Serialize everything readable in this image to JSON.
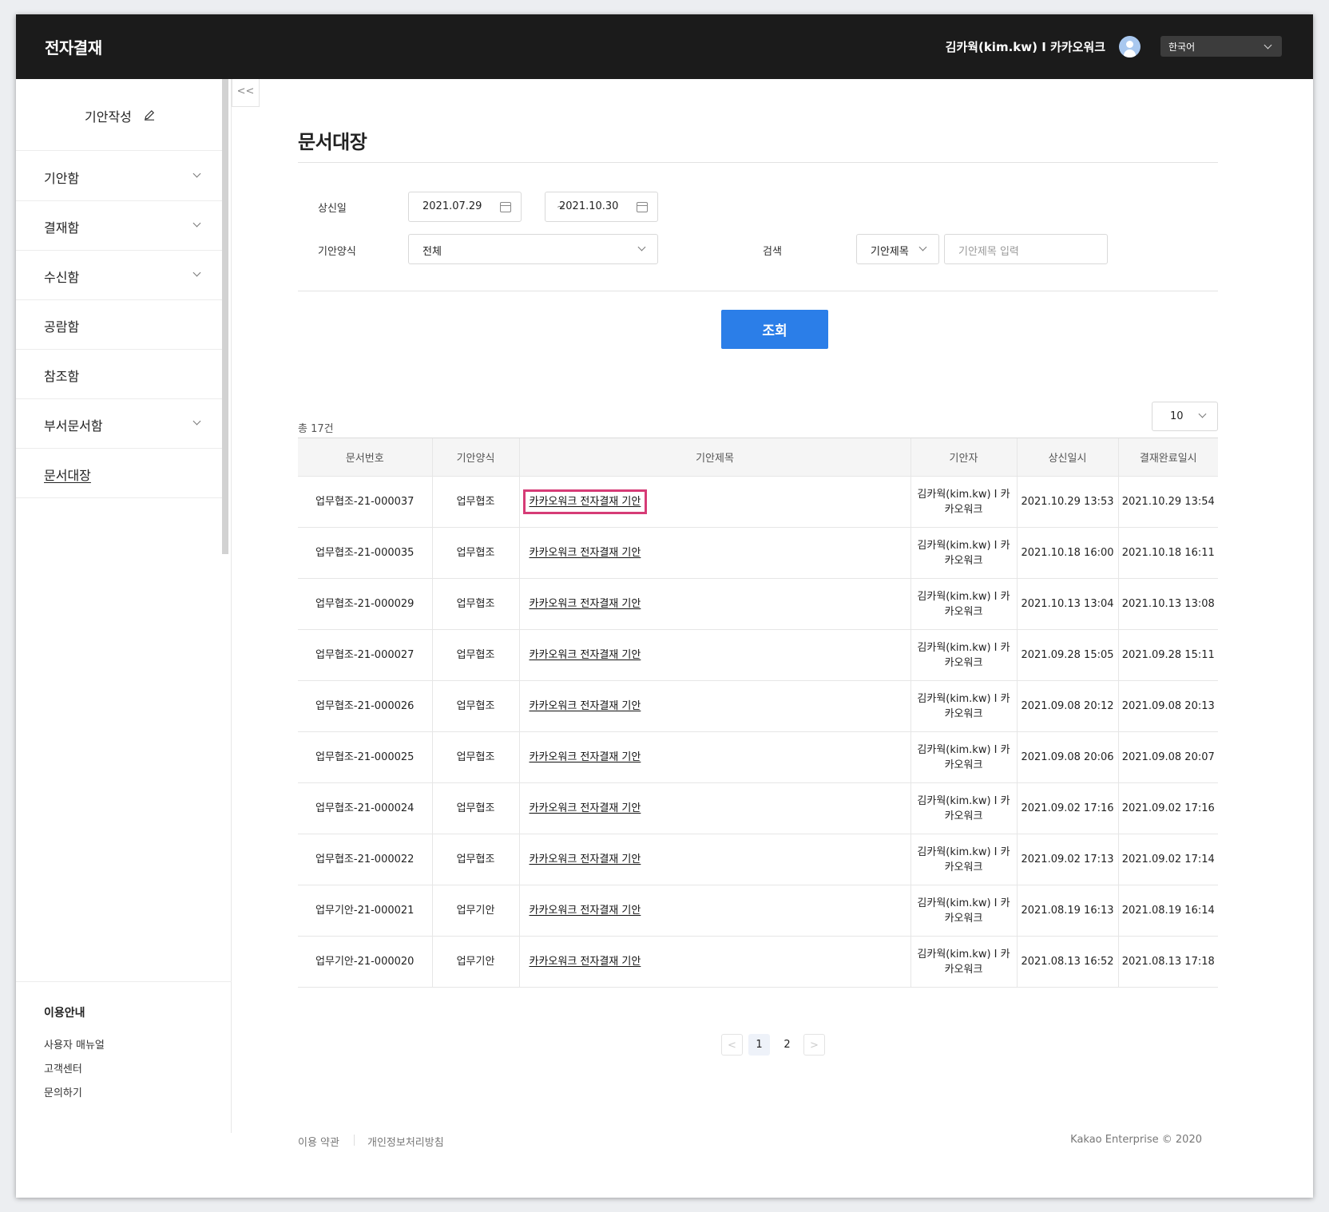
{
  "header": {
    "app_title": "전자결재",
    "user": "김카웍(kim.kw) I 카카오워크",
    "language": "한국어"
  },
  "sidebar": {
    "compose": "기안작성",
    "collapse": "<<",
    "items": [
      {
        "label": "기안함"
      },
      {
        "label": "결재함"
      },
      {
        "label": "수신함"
      },
      {
        "label": "공람함"
      },
      {
        "label": "참조함"
      },
      {
        "label": "부서문서함"
      },
      {
        "label": "문서대장"
      }
    ],
    "guide": {
      "title": "이용안내",
      "links": [
        "사용자 매뉴얼",
        "고객센터",
        "문의하기"
      ]
    }
  },
  "main": {
    "title": "문서대장",
    "filters": {
      "date_label": "상신일",
      "date_from": "2021.07.29",
      "date_to": "2021.10.30",
      "tilde": "~",
      "form_label": "기안양식",
      "form_value": "전체",
      "search_label": "검색",
      "search_type": "기안제목",
      "search_placeholder": "기안제목 입력"
    },
    "search_button": "조회",
    "total": "총 17건",
    "page_size": "10",
    "table": {
      "headers": [
        "문서번호",
        "기안양식",
        "기안제목",
        "기안자",
        "상신일시",
        "결재완료일시"
      ],
      "rows": [
        [
          "업무협조-21-000037",
          "업무협조",
          "카카오워크 전자결재 기안",
          "김카웍(kim.kw) I 카카오워크",
          "2021.10.29 13:53",
          "2021.10.29 13:54"
        ],
        [
          "업무협조-21-000035",
          "업무협조",
          "카카오워크 전자결재 기안",
          "김카웍(kim.kw) I 카카오워크",
          "2021.10.18 16:00",
          "2021.10.18 16:11"
        ],
        [
          "업무협조-21-000029",
          "업무협조",
          "카카오워크 전자결재 기안",
          "김카웍(kim.kw) I 카카오워크",
          "2021.10.13 13:04",
          "2021.10.13 13:08"
        ],
        [
          "업무협조-21-000027",
          "업무협조",
          "카카오워크 전자결재 기안",
          "김카웍(kim.kw) I 카카오워크",
          "2021.09.28 15:05",
          "2021.09.28 15:11"
        ],
        [
          "업무협조-21-000026",
          "업무협조",
          "카카오워크 전자결재 기안",
          "김카웍(kim.kw) I 카카오워크",
          "2021.09.08 20:12",
          "2021.09.08 20:13"
        ],
        [
          "업무협조-21-000025",
          "업무협조",
          "카카오워크 전자결재 기안",
          "김카웍(kim.kw) I 카카오워크",
          "2021.09.08 20:06",
          "2021.09.08 20:07"
        ],
        [
          "업무협조-21-000024",
          "업무협조",
          "카카오워크 전자결재 기안",
          "김카웍(kim.kw) I 카카오워크",
          "2021.09.02 17:16",
          "2021.09.02 17:16"
        ],
        [
          "업무협조-21-000022",
          "업무협조",
          "카카오워크 전자결재 기안",
          "김카웍(kim.kw) I 카카오워크",
          "2021.09.02 17:13",
          "2021.09.02 17:14"
        ],
        [
          "업무기안-21-000021",
          "업무기안",
          "카카오워크 전자결재 기안",
          "김카웍(kim.kw) I 카카오워크",
          "2021.08.19 16:13",
          "2021.08.19 16:14"
        ],
        [
          "업무기안-21-000020",
          "업무기안",
          "카카오워크 전자결재 기안",
          "김카웍(kim.kw) I 카카오워크",
          "2021.08.13 16:52",
          "2021.08.13 17:18"
        ]
      ]
    },
    "pagination": {
      "prev": "<",
      "pages": [
        "1",
        "2"
      ],
      "next": ">"
    }
  },
  "footer": {
    "terms": "이용 약관",
    "privacy": "개인정보처리방침",
    "copyright": "Kakao Enterprise © 2020"
  },
  "colors": {
    "accent": "#2b7ee8",
    "highlight": "#d63b76",
    "topbar": "#1b1b1b"
  }
}
